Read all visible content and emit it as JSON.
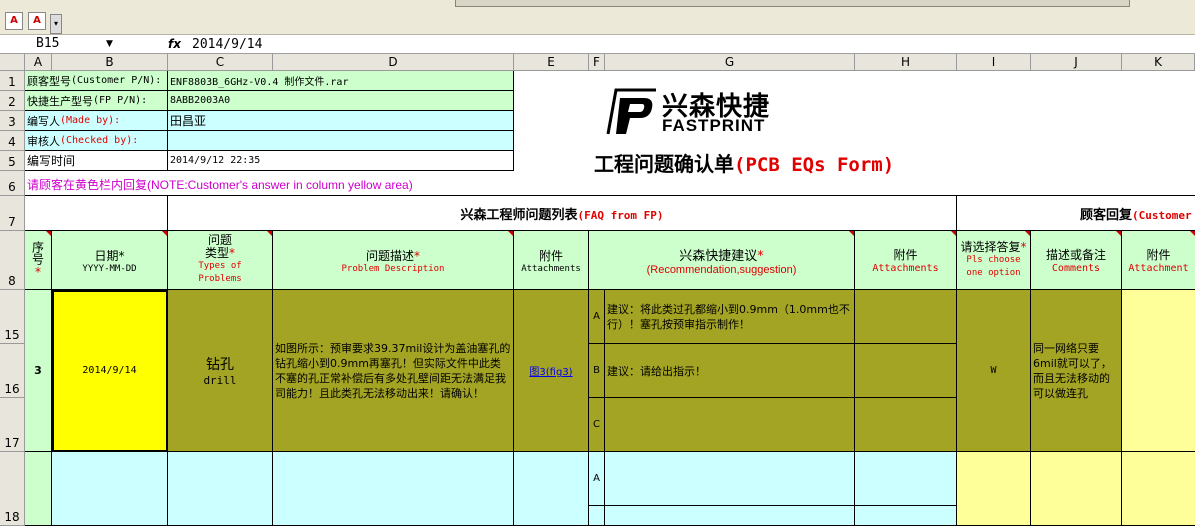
{
  "name_box": "B15",
  "formula_value": "2014/9/14",
  "fx_label": "fx",
  "toolbar": {
    "pdf_icon_1": "pdf-icon",
    "pdf_icon_2": "pdf-icon"
  },
  "columns": [
    "A",
    "B",
    "C",
    "D",
    "E",
    "F",
    "G",
    "H",
    "I",
    "J",
    "K"
  ],
  "rows": [
    "1",
    "2",
    "3",
    "4",
    "5",
    "6",
    "7",
    "8",
    "15",
    "16",
    "17",
    "18"
  ],
  "info": {
    "customer_pn_label_cn": "顾客型号",
    "customer_pn_label_en": "(Customer P/N):",
    "customer_pn_value": "ENF8803B_6GHz-V0.4 制作文件.rar",
    "fp_pn_label_cn": "快捷生产型号",
    "fp_pn_label_en": "(FP P/N):",
    "fp_pn_value": "8ABB2003A0",
    "made_by_label_cn": "编写人",
    "made_by_label_en": "(Made by):",
    "made_by_value": "田昌亚",
    "checked_by_label_cn": "审核人",
    "checked_by_label_en": "(Checked by):",
    "checked_by_value": "",
    "date_label": "编写时间",
    "date_value": "2014/9/12 22:35"
  },
  "logo": {
    "cn": "兴森快捷",
    "en": "FASTPRINT"
  },
  "form_title_cn": "工程问题确认单",
  "form_title_en": "(PCB EQs Form)",
  "note_cn": "请顾客在黄色栏内回复",
  "note_en": "(NOTE:Customer's answer in column yellow area)",
  "section_fp_cn": "兴森工程师问题列表",
  "section_fp_en": "(FAQ from FP)",
  "section_customer_cn": "顾客回复",
  "section_customer_en": "(Customer",
  "headers": {
    "seq_cn": "序号",
    "seq_star": "*",
    "date_cn": "日期*",
    "date_fmt": "YYYY-MM-DD",
    "type_cn_1": "问题",
    "type_cn_2": "类型",
    "type_star": "*",
    "type_en": "Types of Problems",
    "desc_cn": "问题描述",
    "desc_star": "*",
    "desc_en": "Problem Description",
    "attach_cn": "附件",
    "attach_en": "Attachments",
    "rec_cn": "兴森快捷建议",
    "rec_star": "*",
    "rec_en": "(Recommendation,suggestion)",
    "attach2_cn": "附件",
    "attach2_en": "Attachments",
    "choose_cn": "请选择答复",
    "choose_star": "*",
    "choose_en": "Pls choose one option",
    "comments_cn": "描述或备注",
    "comments_en": "Comments",
    "attach3_cn": "附件",
    "attach3_en": "Attachment"
  },
  "issue": {
    "seq": "3",
    "date": "2014/9/14",
    "type_cn": "钻孔",
    "type_en": "drill",
    "description": "如图所示：预审要求39.37mil设计为盖油塞孔的钻孔缩小到0.9mm再塞孔！但实际文件中此类不塞的孔正常补偿后有多处孔壁间距无法满足我司能力！且此类孔无法移动出来！请确认！",
    "attachment": "图3(fig3)",
    "options": [
      {
        "key": "A",
        "text": "建议：将此类过孔都缩小到0.9mm（1.0mm也不行）！塞孔按预审指示制作！"
      },
      {
        "key": "B",
        "text": "建议：请给出指示！"
      },
      {
        "key": "C",
        "text": ""
      }
    ],
    "customer_choice": "W",
    "customer_comment": "同一网络只要6mil就可以了，而且无法移动的可以做连孔"
  },
  "next_row": {
    "option_key": "A"
  },
  "colors": {
    "green": "#ccffcc",
    "cyan": "#ccffff",
    "olive": "#a4a424",
    "yellow": "#ffff00",
    "light_yellow": "#ffff99",
    "red": "#e00000",
    "magenta": "#cc00cc"
  }
}
